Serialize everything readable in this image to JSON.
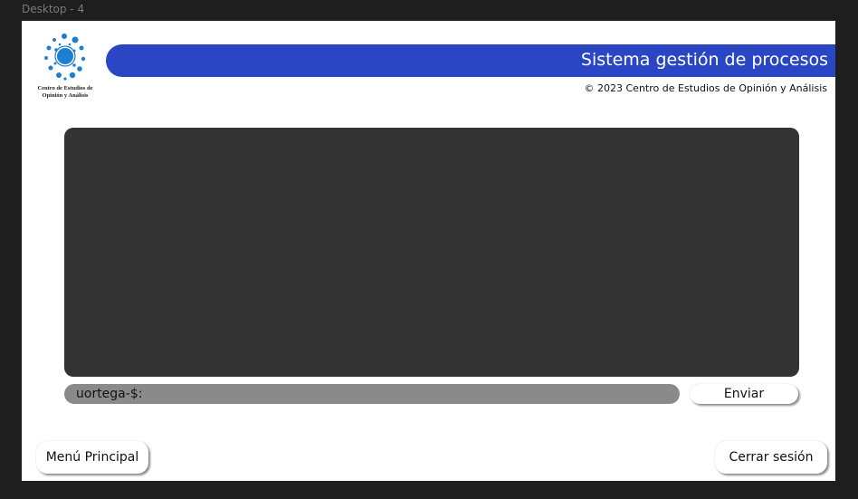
{
  "frame": {
    "label": "Desktop - 4"
  },
  "logo": {
    "name_line1": "Centro de Estudios de",
    "name_line2": "Opinión y Análisis",
    "color": "#1e7fd0"
  },
  "header": {
    "title": "Sistema gestión de procesos",
    "copyright": "© 2023 Centro de Estudios de Opinión y Análisis",
    "bar_color": "#2b46c4"
  },
  "console": {
    "output": ""
  },
  "command": {
    "prompt": "uortega-$:",
    "value": "",
    "send_label": "Enviar"
  },
  "footer": {
    "menu_label": "Menú Principal",
    "logout_label": "Cerrar sesión"
  }
}
